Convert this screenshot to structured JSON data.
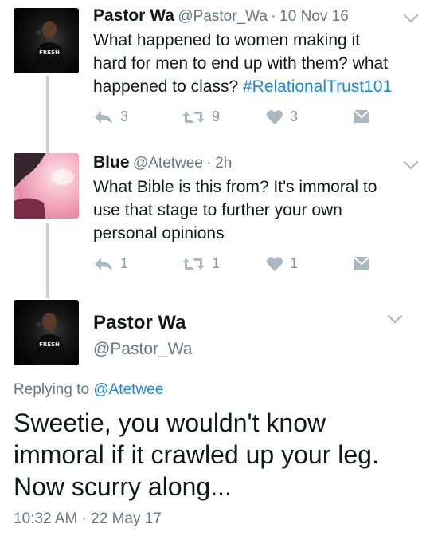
{
  "tweets": [
    {
      "name": "Pastor Wa",
      "handle": "@Pastor_Wa",
      "dot": "·",
      "time": "10 Nov 16",
      "text_lines": [
        "What happened to women making it",
        "hard for men to end up with them? what",
        "happened to class? "
      ],
      "hashtag": "#RelationalTrust101",
      "replies": "3",
      "retweets": "9",
      "likes": "3"
    },
    {
      "name": "Blue",
      "handle": "@Atetwee",
      "dot": "·",
      "time": "2h",
      "text_lines": [
        "What Bible is this from? It's immoral to",
        "use that stage to further your own",
        "personal opinions"
      ],
      "replies": "1",
      "retweets": "1",
      "likes": "1"
    }
  ],
  "main_tweet": {
    "name": "Pastor Wa",
    "handle": "@Pastor_Wa",
    "replying_prefix": "Replying to ",
    "replying_to": "@Atetwee",
    "text_lines": [
      "Sweetie, you wouldn't know",
      "immoral if it crawled up your leg.",
      "Now scurry along..."
    ],
    "timestamp": "10:32 AM · 22 May 17"
  },
  "avatars": {
    "pastor_shirt_text": "FRESH"
  },
  "colors": {
    "link": "#1d8ad6",
    "muted": "#657786",
    "icon": "#8899a6",
    "thread_line": "#c8d0d6"
  },
  "icons": [
    "reply-icon",
    "retweet-icon",
    "like-icon",
    "dm-icon",
    "chevron-down-icon"
  ]
}
